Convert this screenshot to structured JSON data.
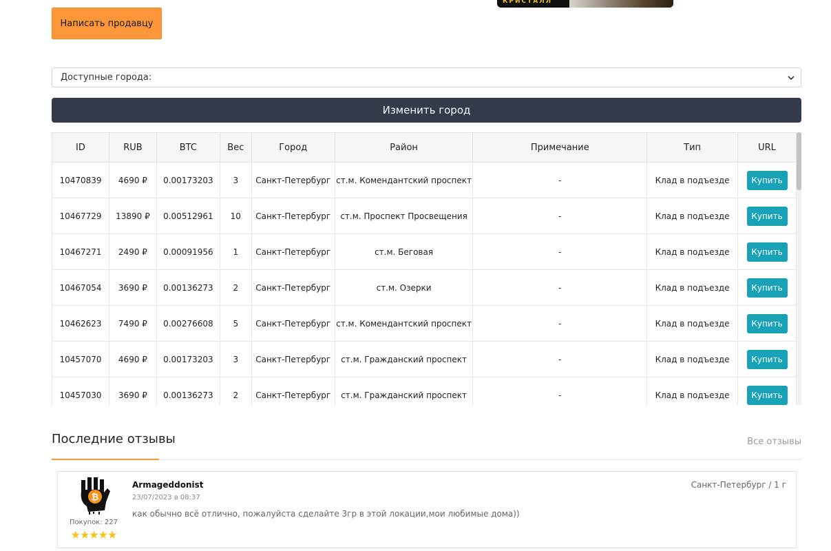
{
  "banner": {
    "text": "КРИСТАЛЛ"
  },
  "seller_button": "Написать продавцу",
  "city_select": {
    "value": "Доступные города:"
  },
  "change_city_button": "Изменить город",
  "table": {
    "headers": [
      "ID",
      "RUB",
      "BTC",
      "Вес",
      "Город",
      "Район",
      "Примечание",
      "Тип",
      "URL"
    ],
    "rows": [
      [
        "10470839",
        "4690 ₽",
        "0.00173203",
        "3",
        "Санкт-Петербург",
        "ст.м. Комендантский проспект",
        "-",
        "Клад в подъезде",
        "Купить"
      ],
      [
        "10467729",
        "13890 ₽",
        "0.00512961",
        "10",
        "Санкт-Петербург",
        "ст.м. Проспект Просвещения",
        "-",
        "Клад в подъезде",
        "Купить"
      ],
      [
        "10467271",
        "2490 ₽",
        "0.00091956",
        "1",
        "Санкт-Петербург",
        "ст.м. Беговая",
        "-",
        "Клад в подъезде",
        "Купить"
      ],
      [
        "10467054",
        "3690 ₽",
        "0.00136273",
        "2",
        "Санкт-Петербург",
        "ст.м. Озерки",
        "-",
        "Клад в подъезде",
        "Купить"
      ],
      [
        "10462623",
        "7490 ₽",
        "0.00276608",
        "5",
        "Санкт-Петербург",
        "ст.м. Комендантский проспект",
        "-",
        "Клад в подъезде",
        "Купить"
      ],
      [
        "10457070",
        "4690 ₽",
        "0.00173203",
        "3",
        "Санкт-Петербург",
        "ст.м. Гражданский проспект",
        "-",
        "Клад в подъезде",
        "Купить"
      ],
      [
        "10457030",
        "3690 ₽",
        "0.00136273",
        "2",
        "Санкт-Петербург",
        "ст.м. Гражданский проспект",
        "-",
        "Клад в подъезде",
        "Купить"
      ]
    ]
  },
  "reviews": {
    "title": "Последние отзывы",
    "all_link": "Все отзывы",
    "items": [
      {
        "name": "Armageddonist",
        "date": "23/07/2023 в 08:37",
        "text": "как обычно всё отлично, пожалуйста сделайте 3гр в этой локации,мои любимые дома))",
        "meta": "Санкт-Петербург / 1 г",
        "purchases": "Покупок: 227",
        "rating": 5,
        "stars": "★★★★★"
      }
    ]
  },
  "colors": {
    "accent_orange": "#fd9638",
    "dark_button": "#343a4a",
    "buy_button": "#17a2b8",
    "star": "#f5c518"
  }
}
